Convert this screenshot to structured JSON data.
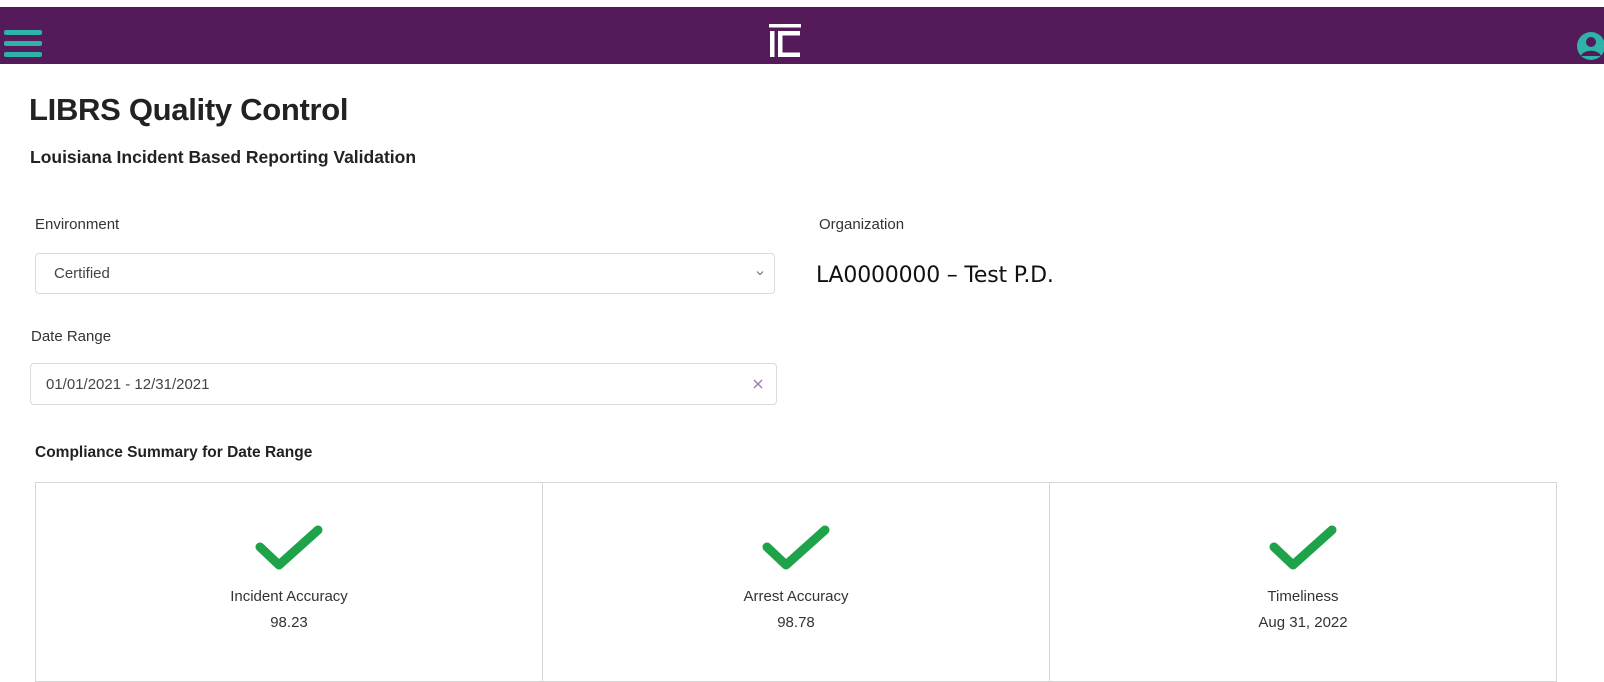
{
  "header": {
    "menu_icon": "hamburger-menu-icon",
    "logo_icon": "ic-logo-icon",
    "user_icon": "user-avatar-icon",
    "colors": {
      "bar": "#541a5a",
      "menu": "#2fb3a8"
    }
  },
  "page": {
    "title": "LIBRS Quality Control",
    "subtitle": "Louisiana Incident Based Reporting Validation"
  },
  "environment": {
    "label": "Environment",
    "selected": "Certified",
    "chevron_icon": "chevron-down-icon"
  },
  "organization": {
    "label": "Organization",
    "value": "LA0000000 – Test P.D."
  },
  "date_range": {
    "label": "Date Range",
    "value": "01/01/2021 - 12/31/2021",
    "clear_icon": "clear-x-icon"
  },
  "summary": {
    "title": "Compliance Summary for Date Range",
    "check_color": "#1fa34a",
    "cards": [
      {
        "label": "Incident Accuracy",
        "value": "98.23",
        "icon": "check-icon"
      },
      {
        "label": "Arrest Accuracy",
        "value": "98.78",
        "icon": "check-icon"
      },
      {
        "label": "Timeliness",
        "value": "Aug 31, 2022",
        "icon": "check-icon"
      }
    ]
  }
}
